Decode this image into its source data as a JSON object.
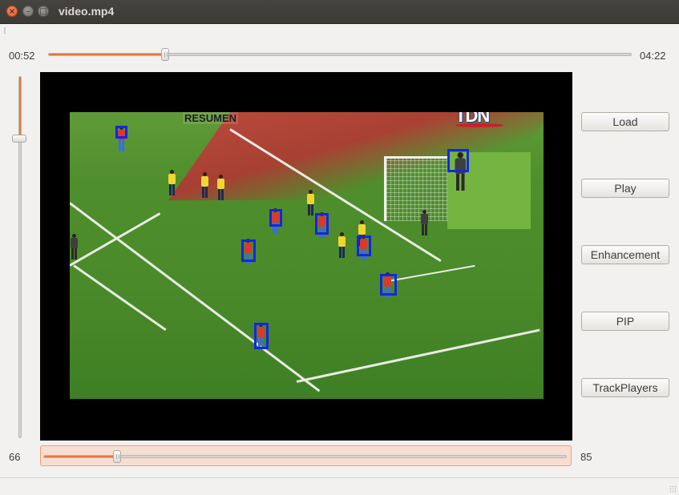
{
  "window": {
    "title": "video.mp4",
    "close_glyph": "×",
    "minimize_glyph": "–",
    "maximize_glyph": "□"
  },
  "playback": {
    "current_time": "00:52",
    "total_time": "04:22",
    "progress_fraction": 0.2
  },
  "vertical_slider": {
    "value_fraction": 0.17
  },
  "bottom_slider": {
    "min_label": "66",
    "max_label": "85",
    "value_fraction": 0.14
  },
  "video": {
    "overlay_text": "RESUMEN",
    "broadcaster_logo": "TDN"
  },
  "buttons": {
    "load": "Load",
    "play": "Play",
    "enhancement": "Enhancement",
    "pip": "PIP",
    "track_players": "TrackPlayers"
  },
  "colors": {
    "accent": "#e9763e",
    "tracking_box": "#1525e6",
    "titlebar": "#3b3a36"
  }
}
